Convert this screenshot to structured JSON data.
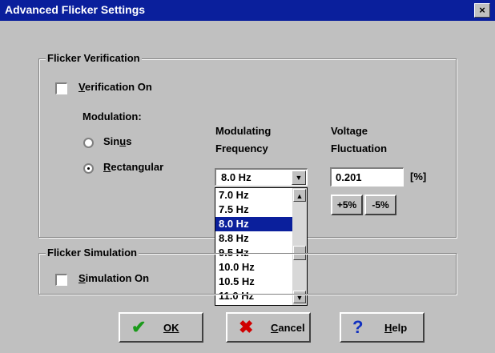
{
  "window": {
    "title": "Advanced Flicker Settings",
    "close_label": "×"
  },
  "verification": {
    "group_label": "Flicker Verification",
    "checkbox_label": "Verification On",
    "checkbox_checked": false,
    "modulation_label": "Modulation:",
    "modulation_options": [
      {
        "label": "Sinus",
        "selected": false
      },
      {
        "label": "Rectangular",
        "selected": true
      }
    ],
    "frequency_label_line1": "Modulating",
    "frequency_label_line2": "Frequency",
    "frequency_value": "8.0 Hz",
    "frequency_options": [
      "7.0 Hz",
      "7.5 Hz",
      "8.0 Hz",
      "8.8 Hz",
      "9.5 Hz",
      "10.0 Hz",
      "10.5 Hz",
      "11.0 Hz"
    ],
    "frequency_selected_index": 2,
    "voltage_label_line1": "Voltage",
    "voltage_label_line2": "Fluctuation",
    "voltage_value": "0.201",
    "voltage_unit": "[%]",
    "plus_button_label": "+5%",
    "minus_button_label": "-5%"
  },
  "simulation": {
    "group_label": "Flicker Simulation",
    "checkbox_label": "Simulation On",
    "checkbox_checked": false
  },
  "buttons": {
    "ok_label": "OK",
    "cancel_label": "Cancel",
    "help_label": "Help"
  },
  "icons": {
    "ok": "checkmark-icon",
    "cancel": "x-icon",
    "help": "question-icon"
  },
  "colors": {
    "title_bar": "#0a1f9c",
    "face": "#c0c0c0",
    "selection": "#0a1f9c",
    "ok_icon": "#1a9a1a",
    "cancel_icon": "#d00000",
    "help_icon": "#1030c0"
  }
}
